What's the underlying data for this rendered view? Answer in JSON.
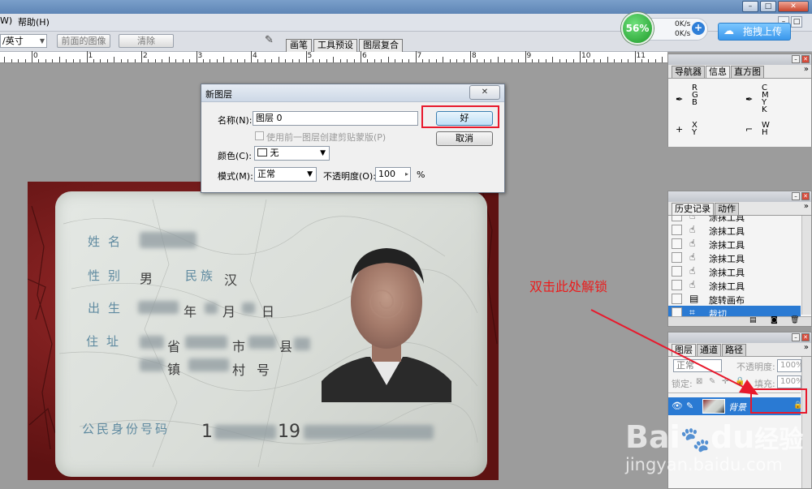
{
  "app": {
    "menu_left": "W)",
    "menu_help": "帮助(H)"
  },
  "options_bar": {
    "unit_value": "/英寸",
    "front_image_button": "前面的图像",
    "clear_button": "清除",
    "dock_tabs": [
      "画笔",
      "工具预设",
      "图层复合"
    ]
  },
  "network": {
    "percent": "56%",
    "upload_speed": "0K/s",
    "download_speed": "0K/s",
    "upload_button": "拖拽上传"
  },
  "ruler": {
    "labels": [
      "0",
      "1",
      "2",
      "3",
      "4",
      "5",
      "6",
      "7",
      "8",
      "9",
      "10",
      "11"
    ]
  },
  "dialog": {
    "title": "新图层",
    "name_label": "名称(N):",
    "name_value": "图层 0",
    "checkbox_label": "使用前一图层创建剪贴蒙版(P)",
    "color_label": "颜色(C):",
    "color_value": "无",
    "mode_label": "模式(M):",
    "mode_value": "正常",
    "opacity_label": "不透明度(O):",
    "opacity_value": "100",
    "opacity_unit": "%",
    "ok_button": "好",
    "cancel_button": "取消"
  },
  "idcard": {
    "name_label": "姓名",
    "gender_label": "性别",
    "gender_value": "男",
    "ethnicity_label": "民族",
    "ethnicity_value": "汉",
    "birth_label": "出生",
    "birth_year": "年",
    "birth_month": "月",
    "birth_day": "日",
    "address_label": "住址",
    "province": "省",
    "city": "市",
    "county": "县",
    "town": "镇",
    "village": "村",
    "number_char": "号",
    "id_label": "公民身份号码",
    "id_part1": "1",
    "id_part2": "19"
  },
  "info_panel": {
    "tabs": [
      "导航器",
      "信息",
      "直方图"
    ],
    "rgb": "R\nG\nB",
    "cmyk": "C\nM\nY\nK",
    "xy": "X\nY",
    "wh": "W\nH"
  },
  "history_panel": {
    "tabs": [
      "历史记录",
      "动作"
    ],
    "items": [
      "涂抹工具",
      "涂抹工具",
      "涂抹工具",
      "涂抹工具",
      "涂抹工具",
      "涂抹工具",
      "旋转画布",
      "裁切"
    ]
  },
  "layers_panel": {
    "tabs": [
      "图层",
      "通道",
      "路径"
    ],
    "blend_mode": "正常",
    "opacity_label": "不透明度:",
    "opacity_value": "100%",
    "lock_label": "锁定:",
    "fill_label": "填充:",
    "fill_value": "100%",
    "layer_name": "背景"
  },
  "annotation": {
    "text": "双击此处解锁"
  },
  "watermark": {
    "logo_a": "Bai",
    "logo_b": "du",
    "logo_cn": "经验",
    "url": "jingyan.baidu.com"
  },
  "colors": {
    "highlight": "#e8192c",
    "selection": "#2a7ad3"
  }
}
